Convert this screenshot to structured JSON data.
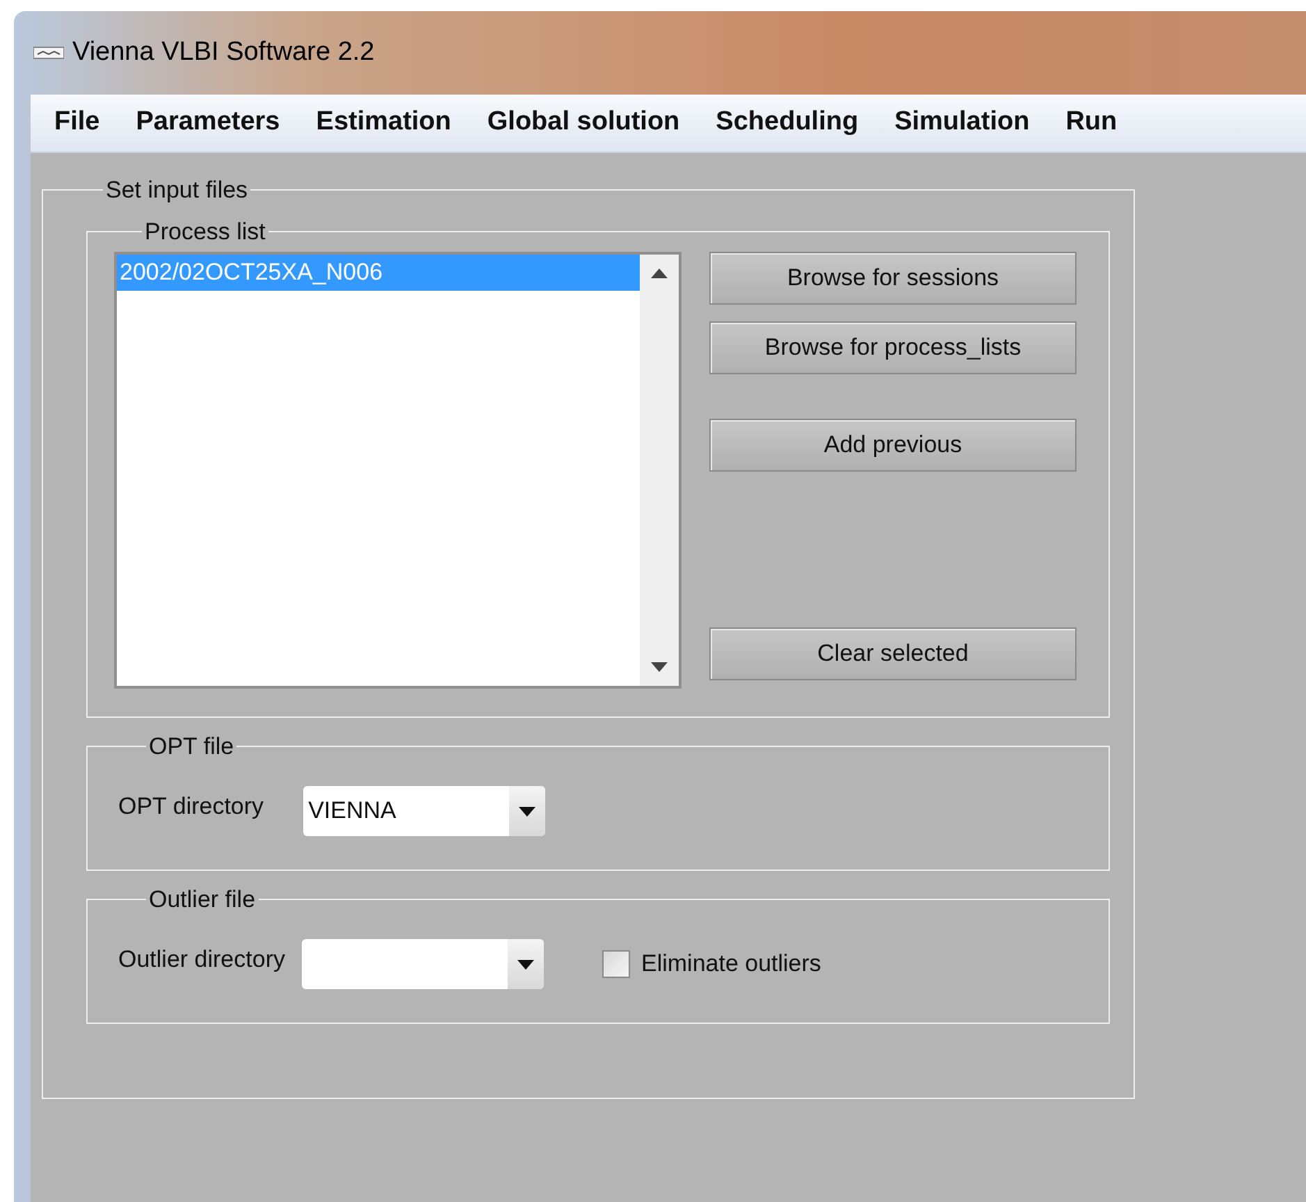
{
  "window": {
    "title": "Vienna VLBI Software 2.2"
  },
  "menu": [
    "File",
    "Parameters",
    "Estimation",
    "Global solution",
    "Scheduling",
    "Simulation",
    "Run"
  ],
  "panel": {
    "title": "Set input files",
    "process_list": {
      "title": "Process list",
      "items": [
        {
          "label": "2002/02OCT25XA_N006",
          "selected": true
        }
      ],
      "buttons": [
        "Browse for sessions",
        "Browse for process_lists",
        "Add previous",
        "Clear selected"
      ]
    },
    "opt_file": {
      "title": "OPT file",
      "label": "OPT directory",
      "value": "VIENNA"
    },
    "outlier_file": {
      "title": "Outlier file",
      "label": "Outlier directory",
      "checkbox": {
        "label": "Eliminate outliers",
        "checked": false
      }
    }
  }
}
